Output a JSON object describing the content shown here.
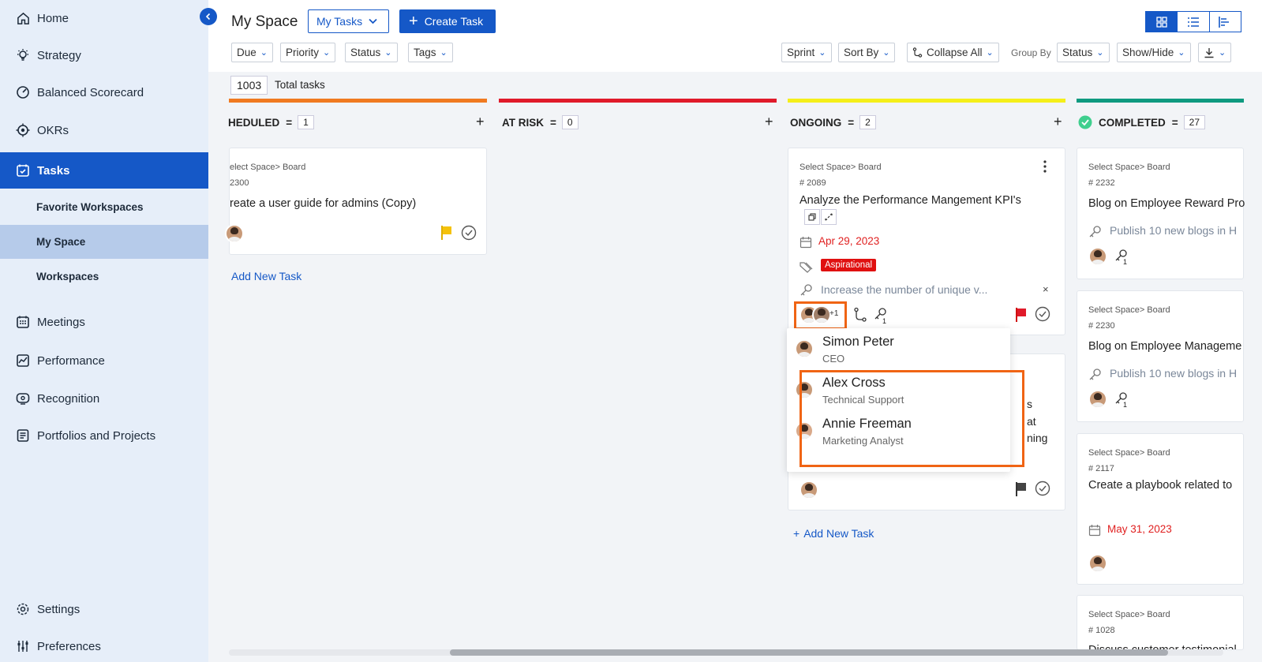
{
  "sidebar": {
    "items": [
      {
        "label": "Home",
        "icon": "home-icon"
      },
      {
        "label": "Strategy",
        "icon": "bulb-icon"
      },
      {
        "label": "Balanced Scorecard",
        "icon": "scorecard-icon"
      },
      {
        "label": "OKRs",
        "icon": "target-icon"
      },
      {
        "label": "Tasks",
        "icon": "tasks-icon"
      },
      {
        "label": "Meetings",
        "icon": "calendar-icon"
      },
      {
        "label": "Performance",
        "icon": "chart-icon"
      },
      {
        "label": "Recognition",
        "icon": "recognition-icon"
      },
      {
        "label": "Portfolios and Projects",
        "icon": "portfolio-icon"
      },
      {
        "label": "Settings",
        "icon": "gear-icon"
      },
      {
        "label": "Preferences",
        "icon": "sliders-icon"
      }
    ],
    "sub_items": [
      {
        "label": "Favorite Workspaces"
      },
      {
        "label": "My Space"
      },
      {
        "label": "Workspaces"
      }
    ]
  },
  "header": {
    "title": "My Space",
    "my_tasks": "My Tasks",
    "create_task": "Create Task"
  },
  "filters": {
    "due": "Due",
    "priority": "Priority",
    "status": "Status",
    "tags": "Tags",
    "sprint": "Sprint",
    "sort_by": "Sort By",
    "collapse_all": "Collapse All",
    "group_by_label": "Group By",
    "group_by_value": "Status",
    "show_hide": "Show/Hide"
  },
  "total": {
    "count": "1003",
    "label": "Total tasks"
  },
  "columns": [
    {
      "name": "HEDULED",
      "count": "1",
      "color": "#f07a20"
    },
    {
      "name": "AT RISK",
      "count": "0",
      "color": "#e01a2a"
    },
    {
      "name": "ONGOING",
      "count": "2",
      "color": "#f5ef1a"
    },
    {
      "name": "COMPLETED",
      "count": "27",
      "color": "#0f9a80"
    }
  ],
  "cards": {
    "scheduled_1": {
      "crumb": "elect Space> Board",
      "id": "2300",
      "title": "reate a user guide for admins (Copy)"
    },
    "ongoing_1": {
      "crumb": "Select Space> Board",
      "id": "# 2089",
      "title": "Analyze the Performance Mangement KPI's",
      "date": "Apr 29, 2023",
      "tag": "Aspirational",
      "kr": "Increase the number of unique v...",
      "more": "+1"
    },
    "ongoing_2_fragments": [
      "s",
      "at",
      "ning"
    ],
    "completed_1": {
      "crumb": "Select Space> Board",
      "id": "# 2232",
      "title": "Blog on Employee Reward Pro",
      "kr": "Publish 10 new blogs in H",
      "kr_count": "1"
    },
    "completed_2": {
      "crumb": "Select Space> Board",
      "id": "# 2230",
      "title": "Blog on Employee Manageme",
      "kr": "Publish 10 new blogs in H",
      "kr_count": "1"
    },
    "completed_3": {
      "crumb": "Select Space> Board",
      "id": "# 2117",
      "title": "Create a playbook related to",
      "date": "May 31, 2023"
    },
    "completed_4": {
      "crumb": "Select Space> Board",
      "id": "# 1028",
      "title": "Discuss customer testimonial"
    }
  },
  "add_new_task": "Add New Task",
  "kr_badge": "1",
  "assignees": [
    {
      "name": "Simon Peter",
      "role": "CEO"
    },
    {
      "name": "Alex Cross",
      "role": "Technical Support"
    },
    {
      "name": "Annie Freeman",
      "role": "Marketing Analyst"
    }
  ],
  "colors": {
    "primary": "#1558c7",
    "highlight": "#f06414",
    "danger": "#e02020"
  }
}
